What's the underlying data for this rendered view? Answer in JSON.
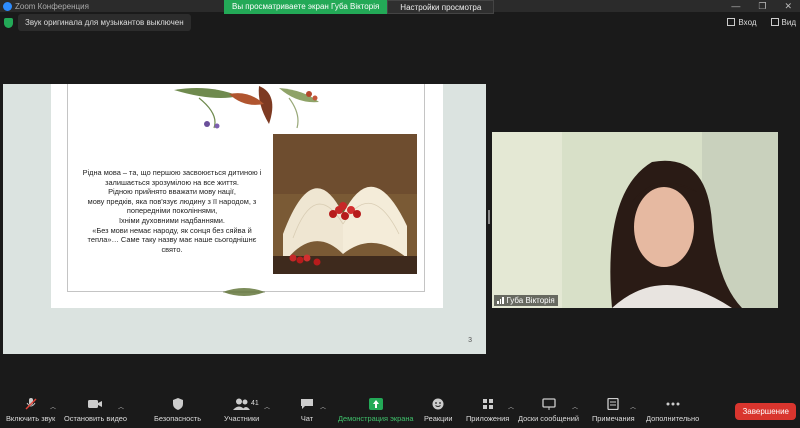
{
  "window": {
    "title": "Zoom Конференция",
    "controls": [
      "—",
      "❐",
      "✕"
    ]
  },
  "share_banner": {
    "status": "Вы просматриваете экран Губа Вікторія",
    "view_options": "Настройки просмотра"
  },
  "audio_notice": {
    "text": "Звук оригинала для музыкантов выключен"
  },
  "top_right": {
    "login": "Вход",
    "view": "Вид"
  },
  "slide": {
    "text_lines": [
      "Рідна мова – та, що першою засвоюється дитиною і",
      "залишається зрозумілою на все життя.",
      "Рідною прийнято вважати мову нації,",
      " мову предків, яка пов'язує людину з її народом, з",
      "попередніми поколіннями,",
      " їхніми духовними надбаннями.",
      "«Без мови немає народу, як сонця без сяйва й",
      "тепла»… Саме таку назву має наше сьогоднішнє",
      "свято."
    ],
    "page_number": "3"
  },
  "video": {
    "participant_name": "Губа Вікторія"
  },
  "toolbar": {
    "items": [
      {
        "label": "Включить звук",
        "icon": "mic-muted-icon"
      },
      {
        "label": "Остановить видео",
        "icon": "video-camera-icon"
      },
      {
        "label": "Безопасность",
        "icon": "shield-icon"
      },
      {
        "label": "Участники",
        "icon": "participants-icon",
        "badge": "41"
      },
      {
        "label": "Чат",
        "icon": "chat-icon"
      },
      {
        "label": "Демонстрация экрана",
        "icon": "share-screen-icon"
      },
      {
        "label": "Реакции",
        "icon": "reaction-icon"
      },
      {
        "label": "Приложения",
        "icon": "apps-icon"
      },
      {
        "label": "Доски сообщений",
        "icon": "whiteboard-icon"
      },
      {
        "label": "Примечания",
        "icon": "notes-icon"
      },
      {
        "label": "Дополнительно",
        "icon": "more-icon"
      }
    ],
    "end_label": "Завершение"
  },
  "colors": {
    "accent_green": "#23a957",
    "end_red": "#d9352e",
    "background": "#1a1a1a"
  }
}
